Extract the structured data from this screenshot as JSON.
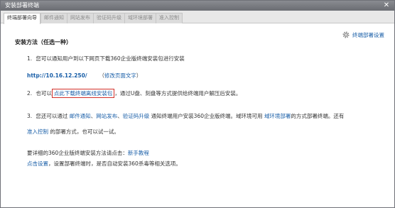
{
  "window": {
    "title": "安装部署终端",
    "close_glyph": "✕"
  },
  "tabs": [
    {
      "label": "终端部署向导",
      "active": true
    },
    {
      "label": "邮件通知",
      "active": false
    },
    {
      "label": "网站发布",
      "active": false
    },
    {
      "label": "验证码升级",
      "active": false
    },
    {
      "label": "域环境部署",
      "active": false
    },
    {
      "label": "准入控制",
      "active": false
    }
  ],
  "settings_link": {
    "label": "终端部署设置",
    "icon": "gear-icon"
  },
  "heading": "安装方法（任选一种）",
  "step1": {
    "number": "1.",
    "text": "您可以通知用户到以下网页下载360企业版终端安装包进行安装",
    "url": "http://10.16.12.250/",
    "edit_open": "（",
    "edit_link": "修改页面文字",
    "edit_close": "）"
  },
  "step2": {
    "number": "2.",
    "prefix": "也可以",
    "download_link": "点此下载终端离线安装包",
    "suffix": "，通过U盘、刻盘等方式提供给终端用户解压后安装。"
  },
  "step3": {
    "number": "3.",
    "prefix": "您还可以通过",
    "link_mail": "邮件通知",
    "sep1": "、",
    "link_web": "网站发布",
    "sep2": "、",
    "link_captcha": "验证码升级",
    "mid": "通知终端用户安装360企业版终端。域环境可用",
    "link_domain": "域环境部署",
    "tail": "的方式部署终端。还有",
    "link_access": "准入控制",
    "line2_suffix": "的部署方式，也可以试一试。"
  },
  "tutorial": {
    "prefix": "要详细的360企业版终端安装方法请点击：",
    "link": "新手教程"
  },
  "auto_setting": {
    "link": "点击设置",
    "suffix": "，设置部署终端时，是否自动安装360杀毒等相关选项。"
  },
  "colors": {
    "titlebar": "#707278",
    "link": "#1a5fa8",
    "highlight_border": "#d2302a"
  }
}
